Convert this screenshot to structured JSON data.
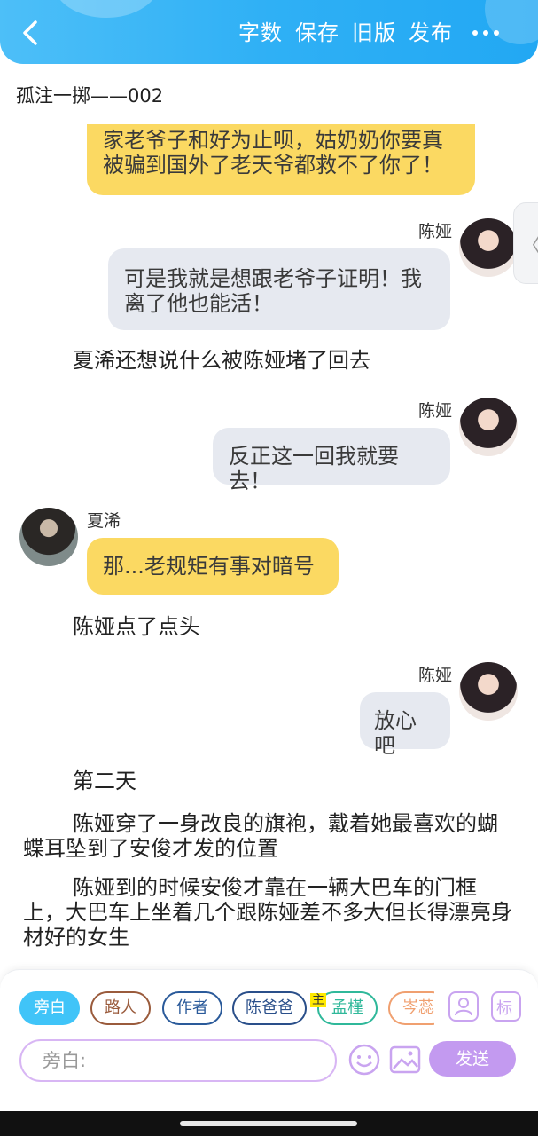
{
  "topbar": {
    "actions": [
      "字数",
      "保存",
      "旧版",
      "发布"
    ]
  },
  "doc_title": "孤注一掷——002",
  "messages": {
    "m1": "家老爷子和好为止呗，姑奶奶你要真被骗到国外了老天爷都救不了你了！",
    "m2_name": "陈娅",
    "m2": "可是我就是想跟老爷子证明！我离了他也能活！",
    "n1": "夏浠还想说什么被陈娅堵了回去",
    "m3_name": "陈娅",
    "m3": "反正这一回我就要去！",
    "m4_name": "夏浠",
    "m4": "那...老规矩有事对暗号",
    "n2": "陈娅点了点头",
    "m5_name": "陈娅",
    "m5": "放心吧",
    "n3": "第二天",
    "n4": "陈娅穿了一身改良的旗袍，戴着她最喜欢的蝴蝶耳坠到了安俊才发的位置",
    "n5": "陈娅到的时候安俊才靠在一辆大巴车的门框上，大巴车上坐着几个跟陈娅差不多大但长得漂亮身材好的女生"
  },
  "side_tab": "〈",
  "chips": [
    {
      "label": "旁白",
      "color": "#40c4f8"
    },
    {
      "label": "路人",
      "color": "#9a5b3c"
    },
    {
      "label": "作者",
      "color": "#2a5a9a"
    },
    {
      "label": "陈爸爸",
      "color": "#2a4f8a"
    },
    {
      "label": "孟槿",
      "color": "#2fb89a"
    },
    {
      "label": "岑蕊",
      "color": "#f0a070"
    }
  ],
  "chip_badge": "主",
  "tool_label": "标",
  "input": {
    "placeholder": "旁白:"
  },
  "send_label": "发送",
  "colors": {
    "accent": "#2fb0f5",
    "purple": "#c39af0",
    "yellow_bubble": "#fbd962",
    "gray_bubble": "#e6e9f0"
  }
}
